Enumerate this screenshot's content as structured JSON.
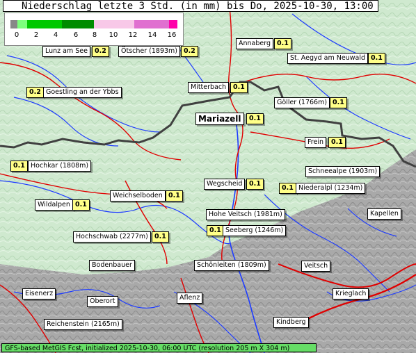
{
  "title": "Niederschlag letzte 3 Std. (in mm) bis Do, 2025-10-30, 13:00 MEZ",
  "legend": {
    "ticks": [
      "0",
      "2",
      "4",
      "6",
      "8",
      "10",
      "12",
      "14",
      "16"
    ],
    "colors": [
      "#7dff7d",
      "#00c800",
      "#008c00",
      "#f8c8e8",
      "#e070d0",
      "#ff00aa"
    ]
  },
  "places": [
    {
      "name": "Lunz am See",
      "value": "0.2"
    },
    {
      "name": "Ötscher (1893m)",
      "value": "0.2"
    },
    {
      "name": "Annaberg",
      "value": "0.1"
    },
    {
      "name": "St. Aegyd am Neuwald",
      "value": "0.1"
    },
    {
      "name": "Goestling an der Ybbs",
      "value": "0.2"
    },
    {
      "name": "Mitterbach",
      "value": "0.1"
    },
    {
      "name": "Göller (1766m)",
      "value": "0.1"
    },
    {
      "name": "Mariazell",
      "value": "0.1"
    },
    {
      "name": "Frein",
      "value": "0.1"
    },
    {
      "name": "Hochkar (1808m)",
      "value": "0.1"
    },
    {
      "name": "Schneealpe (1903m)",
      "value": ""
    },
    {
      "name": "Wegscheid",
      "value": "0.1"
    },
    {
      "name": "Niederalpl (1234m)",
      "value": "0.1"
    },
    {
      "name": "Weichselboden",
      "value": "0.1"
    },
    {
      "name": "Wildalpen",
      "value": "0.1"
    },
    {
      "name": "Hohe Veitsch (1981m)",
      "value": ""
    },
    {
      "name": "Kapellen",
      "value": ""
    },
    {
      "name": "Seeberg (1246m)",
      "value": "0.1"
    },
    {
      "name": "Hochschwab (2277m)",
      "value": "0.1"
    },
    {
      "name": "Bodenbauer",
      "value": ""
    },
    {
      "name": "Schönleiten (1809m)",
      "value": ""
    },
    {
      "name": "Veitsch",
      "value": ""
    },
    {
      "name": "Eisenerz",
      "value": ""
    },
    {
      "name": "Oberort",
      "value": ""
    },
    {
      "name": "Aflenz",
      "value": ""
    },
    {
      "name": "Krieglach",
      "value": ""
    },
    {
      "name": "Reichenstein (2165m)",
      "value": ""
    },
    {
      "name": "Kindberg",
      "value": ""
    }
  ],
  "footer": "GFS-based MetGIS Fcst, initialized 2025-10-30, 06:00 UTC  (resolution 205 m X 304 m)",
  "colors": {
    "lowland": "#cfe9cf",
    "mountain_gray": "#a8a8a8",
    "river": "#1e3cff",
    "road": "#e00000",
    "border": "#404040"
  }
}
